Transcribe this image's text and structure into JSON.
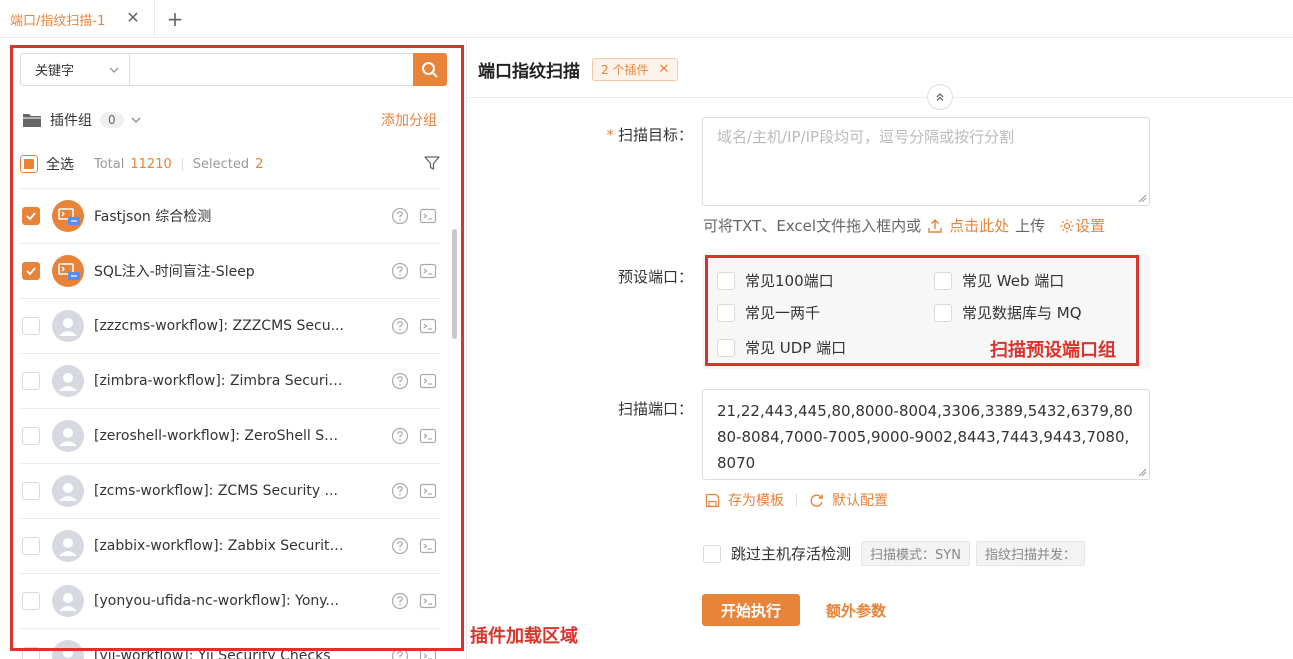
{
  "tabs": {
    "active_label": "端口/指纹扫描-1"
  },
  "sidebar": {
    "search_type": "关键字",
    "search_value": "",
    "group_label": "插件组",
    "group_count": "0",
    "add_group_label": "添加分组",
    "select_all_label": "全选",
    "total_label": "Total",
    "total_value": "11210",
    "selected_label": "Selected",
    "selected_value": "2",
    "plugins": [
      {
        "name": "Fastjson 综合检测",
        "checked": true,
        "icon": "custom-plugin-icon"
      },
      {
        "name": "SQL注入-时间盲注-Sleep",
        "checked": true,
        "icon": "custom-plugin-icon"
      },
      {
        "name": "[zzzcms-workflow]: ZZZCMS Secu...",
        "checked": false,
        "icon": "user-avatar-icon"
      },
      {
        "name": "[zimbra-workflow]: Zimbra Securit...",
        "checked": false,
        "icon": "user-avatar-icon"
      },
      {
        "name": "[zeroshell-workflow]: ZeroShell Se...",
        "checked": false,
        "icon": "user-avatar-icon"
      },
      {
        "name": "[zcms-workflow]: ZCMS Security ...",
        "checked": false,
        "icon": "user-avatar-icon"
      },
      {
        "name": "[zabbix-workflow]: Zabbix Security...",
        "checked": false,
        "icon": "user-avatar-icon"
      },
      {
        "name": "[yonyou-ufida-nc-workflow]: Yony...",
        "checked": false,
        "icon": "user-avatar-icon"
      },
      {
        "name": "[yii-workflow]: Yii Security Checks",
        "checked": false,
        "icon": "user-avatar-icon"
      }
    ]
  },
  "annotations": {
    "left": "插件加载区域",
    "right": "扫描预设端口组"
  },
  "main": {
    "title": "端口指纹扫描",
    "plugin_tag": "2 个插件",
    "target_label": "扫描目标：",
    "target_placeholder": "域名/主机/IP/IP段均可，逗号分隔或按行分割",
    "upload_hint": "可将TXT、Excel文件拖入框内或",
    "upload_link": "点击此处",
    "upload_after": "上传",
    "settings_link": "设置",
    "preset_label": "预设端口：",
    "presets": [
      {
        "label": "常见100端口"
      },
      {
        "label": "常见 Web 端口"
      },
      {
        "label": "常见一两千"
      },
      {
        "label": "常见数据库与 MQ"
      },
      {
        "label": "常见 UDP 端口"
      }
    ],
    "ports_label": "扫描端口：",
    "ports_value": "21,22,443,445,80,8000-8004,3306,3389,5432,6379,8080-8084,7000-7005,9000-9002,8443,7443,9443,7080,8070",
    "save_template": "存为模板",
    "default_config": "默认配置",
    "skip_host_check": "跳过主机存活检测",
    "scan_mode_chip": "扫描模式：SYN",
    "fingerprint_chip": "指纹扫描并发：",
    "run_button": "开始执行",
    "extra_params": "额外参数"
  },
  "colors": {
    "accent": "#e8833a",
    "annotation_red": "#d9342b"
  }
}
